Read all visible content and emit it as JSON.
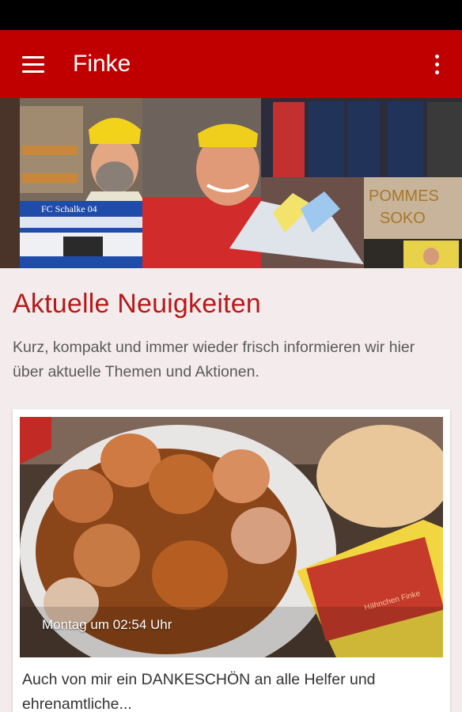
{
  "app_bar": {
    "title": "Finke",
    "menu_icon": "hamburger-menu-icon",
    "overflow_icon": "more-vert-icon",
    "color": "#c00000"
  },
  "hero": {
    "banner_text": "FC Schalke 04",
    "sign_text_1": "POMMES",
    "sign_text_2": "SOKO"
  },
  "news": {
    "title": "Aktuelle Neuigkeiten",
    "description": "Kurz, kompakt und immer wieder frisch informieren wir hier über aktuelle Themen und Aktionen.",
    "title_color": "#b81818"
  },
  "post": {
    "timestamp": "Montag um 02:54 Uhr",
    "excerpt": "Auch von mir ein DANKESCHÖN an alle Helfer und ehrenamtliche...",
    "napkin_text": "Hähnchen Finke"
  }
}
